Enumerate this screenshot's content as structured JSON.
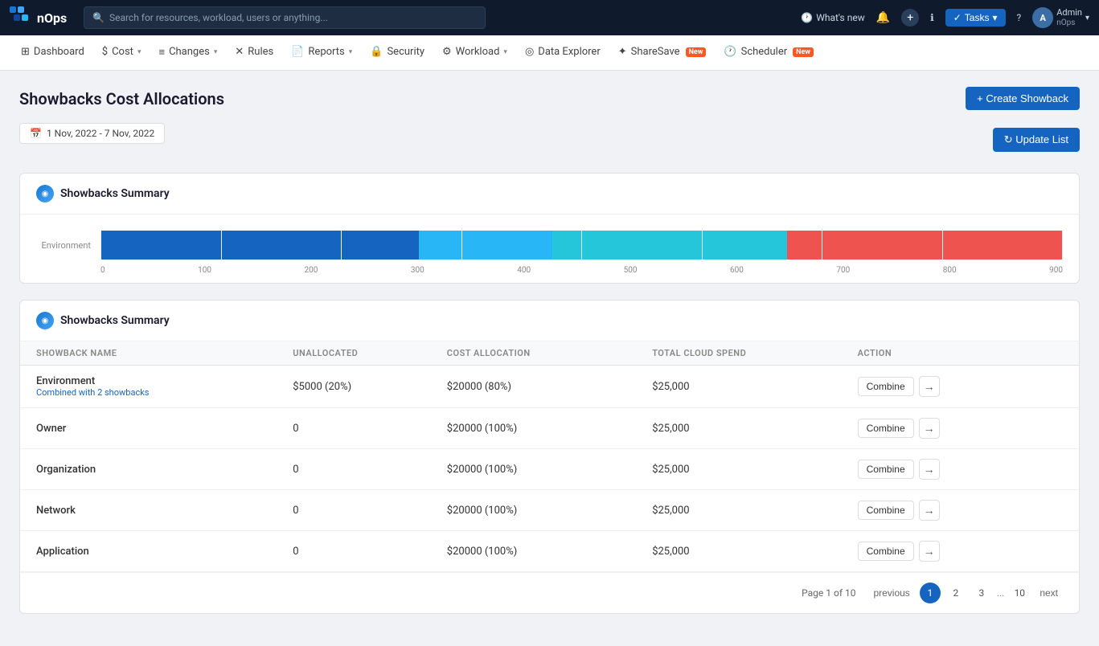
{
  "topnav": {
    "logo_text": "nOps",
    "search_placeholder": "Search for resources, workload, users or anything...",
    "whats_new": "What's new",
    "tasks_label": "Tasks",
    "admin_name": "Admin",
    "admin_sub": "nOps"
  },
  "menubar": {
    "items": [
      {
        "id": "dashboard",
        "label": "Dashboard",
        "icon": "⊞",
        "has_caret": false
      },
      {
        "id": "cost",
        "label": "Cost",
        "icon": "$",
        "has_caret": true
      },
      {
        "id": "changes",
        "label": "Changes",
        "icon": "≡",
        "has_caret": true
      },
      {
        "id": "rules",
        "label": "Rules",
        "icon": "✕",
        "has_caret": false
      },
      {
        "id": "reports",
        "label": "Reports",
        "icon": "📄",
        "has_caret": true
      },
      {
        "id": "security",
        "label": "Security",
        "icon": "🔒",
        "has_caret": false
      },
      {
        "id": "workload",
        "label": "Workload",
        "icon": "⚙",
        "has_caret": true
      },
      {
        "id": "data-explorer",
        "label": "Data Explorer",
        "icon": "◎",
        "has_caret": false
      },
      {
        "id": "sharesave",
        "label": "ShareSave",
        "icon": "✦",
        "has_caret": false,
        "badge": "New"
      },
      {
        "id": "scheduler",
        "label": "Scheduler",
        "icon": "🕐",
        "has_caret": false,
        "badge": "New"
      }
    ]
  },
  "page": {
    "title": "Showbacks Cost Allocations",
    "create_btn_label": "+ Create Showback",
    "update_btn_label": "↻ Update List",
    "date_range": "1 Nov, 2022 - 7 Nov, 2022"
  },
  "chart": {
    "title": "Showbacks Summary",
    "y_label": "Environment",
    "x_ticks": [
      "0",
      "100",
      "200",
      "300",
      "400",
      "500",
      "600",
      "700",
      "800",
      "900"
    ],
    "segments": [
      {
        "label": "Blue segment",
        "color": "#1565c0",
        "width_pct": 40
      },
      {
        "label": "Light blue segment",
        "color": "#29b6f6",
        "width_pct": 17
      },
      {
        "label": "Teal segment",
        "color": "#26c6da",
        "width_pct": 28
      },
      {
        "label": "Red segment",
        "color": "#ef5350",
        "width_pct": 33
      }
    ]
  },
  "summary_table": {
    "title": "Showbacks Summary",
    "headers": [
      "SHOWBACK NAME",
      "UNALLOCATED",
      "COST ALLOCATION",
      "TOTAL CLOUD SPEND",
      "ACTION"
    ],
    "rows": [
      {
        "name": "Environment",
        "combined_label": "Combined with 2 showbacks",
        "unallocated": "$5000 (20%)",
        "cost_allocation": "$20000 (80%)",
        "total_cloud_spend": "$25,000",
        "action_combine": "Combine"
      },
      {
        "name": "Owner",
        "combined_label": "",
        "unallocated": "0",
        "cost_allocation": "$20000 (100%)",
        "total_cloud_spend": "$25,000",
        "action_combine": "Combine"
      },
      {
        "name": "Organization",
        "combined_label": "",
        "unallocated": "0",
        "cost_allocation": "$20000 (100%)",
        "total_cloud_spend": "$25,000",
        "action_combine": "Combine"
      },
      {
        "name": "Network",
        "combined_label": "",
        "unallocated": "0",
        "cost_allocation": "$20000 (100%)",
        "total_cloud_spend": "$25,000",
        "action_combine": "Combine"
      },
      {
        "name": "Application",
        "combined_label": "",
        "unallocated": "0",
        "cost_allocation": "$20000 (100%)",
        "total_cloud_spend": "$25,000",
        "action_combine": "Combine"
      }
    ]
  },
  "pagination": {
    "page_info": "Page 1 of 10",
    "previous": "previous",
    "next": "next",
    "pages": [
      "1",
      "2",
      "3",
      "...",
      "10"
    ],
    "current_page": "1"
  }
}
